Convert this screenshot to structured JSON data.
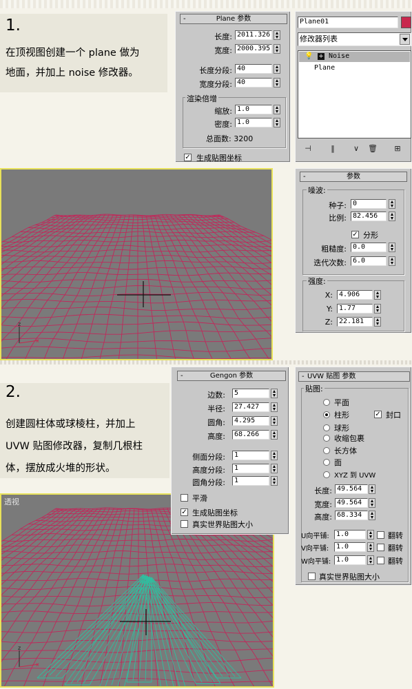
{
  "step1": {
    "number": "1.",
    "lines": [
      "在顶视图创建一个 plane 做为",
      "地面，并加上 noise 修改器。"
    ]
  },
  "plane_params": {
    "title": "Plane 参数",
    "length_label": "长度:",
    "length_value": "2011.326",
    "width_label": "宽度:",
    "width_value": "2000.395",
    "length_segs_label": "长度分段:",
    "length_segs_value": "40",
    "width_segs_label": "宽度分段:",
    "width_segs_value": "40",
    "render_group": "渲染倍增",
    "scale_label": "缩放:",
    "scale_value": "1.0",
    "density_label": "密度:",
    "density_value": "1.0",
    "total_faces": "总面数: 3200",
    "gen_mapping": "生成贴图坐标"
  },
  "modifier_panel": {
    "object_name": "Plane01",
    "object_color": "#c8284e",
    "modifier_list": "修改器列表",
    "stack": [
      "Noise",
      "Plane"
    ]
  },
  "noise_params": {
    "title": "参数",
    "noise_group": "噪波:",
    "seed_label": "种子:",
    "seed_value": "0",
    "scale_label": "比例:",
    "scale_value": "82.456",
    "fractal_label": "分形",
    "roughness_label": "粗糙度:",
    "roughness_value": "0.0",
    "iterations_label": "迭代次数:",
    "iterations_value": "6.0",
    "strength_group": "强度:",
    "x_label": "X:",
    "x_value": "4.906",
    "y_label": "Y:",
    "y_value": "1.77",
    "z_label": "Z:",
    "z_value": "22.181"
  },
  "step2": {
    "number": "2.",
    "lines": [
      "创建圆柱体或球棱柱，并加上",
      "UVW 贴图修改器，复制几根柱",
      "体，摆放成火堆的形状。"
    ]
  },
  "viewport2_label": "透视",
  "gengon_params": {
    "title": "Gengon 参数",
    "sides_label": "边数:",
    "sides_value": "5",
    "radius_label": "半径:",
    "radius_value": "27.427",
    "fillet_label": "圆角:",
    "fillet_value": "4.295",
    "height_label": "高度:",
    "height_value": "68.266",
    "side_segs_label": "侧面分段:",
    "side_segs_value": "1",
    "height_segs_label": "高度分段:",
    "height_segs_value": "1",
    "fillet_segs_label": "圆角分段:",
    "fillet_segs_value": "1",
    "smooth_label": "平滑",
    "gen_mapping": "生成贴图坐标",
    "real_world": "真实世界贴图大小"
  },
  "uvw_params": {
    "title": "UVW 贴图 参数",
    "map_group": "贴图:",
    "options": [
      "平面",
      "柱形",
      "球形",
      "收缩包裹",
      "长方体",
      "面",
      "XYZ 到 UVW"
    ],
    "selected_index": 1,
    "cap_label": "封口",
    "length_label": "长度:",
    "length_value": "49.564",
    "width_label": "宽度:",
    "width_value": "49.564",
    "height_label": "高度:",
    "height_value": "68.334",
    "u_label": "U向平铺:",
    "u_value": "1.0",
    "v_label": "V向平铺:",
    "v_value": "1.0",
    "w_label": "W向平铺:",
    "w_value": "1.0",
    "flip_label": "翻转",
    "real_world": "真实世界贴图大小"
  },
  "colors": {
    "mesh": "#c0285a",
    "gengon": "#2fbfa0",
    "viewport_border": "#e8e25a",
    "panel": "#c8c8c8"
  }
}
